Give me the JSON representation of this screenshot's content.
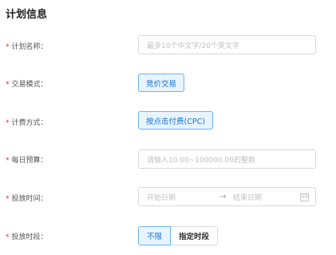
{
  "section_title": "计划信息",
  "fields": {
    "plan_name": {
      "label": "计划名称：",
      "placeholder": "最多10个中文字/20个英文字"
    },
    "trade_mode": {
      "label": "交易模式：",
      "value": "竞价交易"
    },
    "billing": {
      "label": "计费方式：",
      "value": "按点击付费(CPC)"
    },
    "daily_budget": {
      "label": "每日预算：",
      "placeholder": "请输入10.00~100000.00的整数"
    },
    "schedule": {
      "label": "投放时间：",
      "start_placeholder": "开始日期",
      "arrow": "→",
      "end_placeholder": "结束日期"
    },
    "time_slot": {
      "label": "投放时段：",
      "options": [
        "不限",
        "指定时段"
      ],
      "selected": "不限"
    }
  },
  "required_mark": "*",
  "colors": {
    "accent": "#1677d6",
    "required": "#f5222d"
  }
}
